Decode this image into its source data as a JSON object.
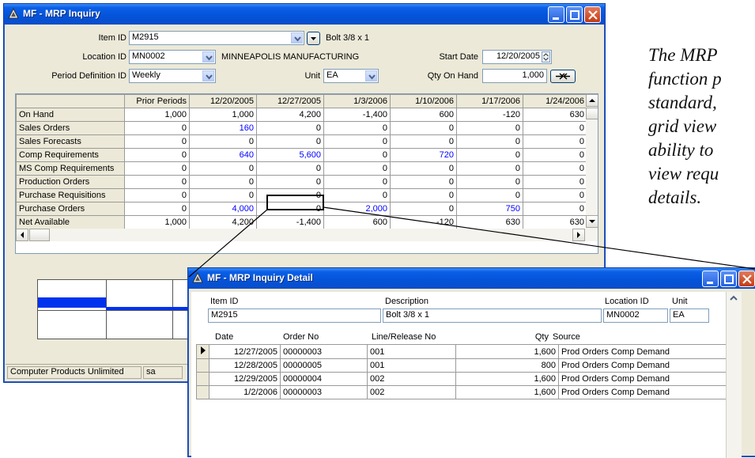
{
  "main_window": {
    "title": "MF - MRP Inquiry",
    "item_id_label": "Item ID",
    "item_id_value": "M2915",
    "item_description": "Bolt 3/8 x 1",
    "location_id_label": "Location ID",
    "location_id_value": "MN0002",
    "location_name": "MINNEAPOLIS MANUFACTURING",
    "start_date_label": "Start Date",
    "start_date_value": "12/20/2005",
    "period_label": "Period Definition ID",
    "period_value": "Weekly",
    "unit_label": "Unit",
    "unit_value": "EA",
    "qty_on_hand_label": "Qty On Hand",
    "qty_on_hand_value": "1,000",
    "grid": {
      "columns": [
        "",
        "Prior Periods",
        "12/20/2005",
        "12/27/2005",
        "1/3/2006",
        "1/10/2006",
        "1/17/2006",
        "1/24/2006"
      ],
      "rows": [
        {
          "label": "On Hand",
          "values": [
            "1,000",
            "1,000",
            "4,200",
            "-1,400",
            "600",
            "-120",
            "630"
          ]
        },
        {
          "label": "Sales Orders",
          "values": [
            "0",
            "160",
            "0",
            "0",
            "0",
            "0",
            "0"
          ]
        },
        {
          "label": "Sales Forecasts",
          "values": [
            "0",
            "0",
            "0",
            "0",
            "0",
            "0",
            "0"
          ]
        },
        {
          "label": "Comp Requirements",
          "values": [
            "0",
            "640",
            "5,600",
            "0",
            "720",
            "0",
            "0"
          ]
        },
        {
          "label": "MS Comp Requirements",
          "values": [
            "0",
            "0",
            "0",
            "0",
            "0",
            "0",
            "0"
          ]
        },
        {
          "label": "Production Orders",
          "values": [
            "0",
            "0",
            "0",
            "0",
            "0",
            "0",
            "0"
          ]
        },
        {
          "label": "Purchase Requisitions",
          "values": [
            "0",
            "0",
            "0",
            "0",
            "0",
            "0",
            "0"
          ]
        },
        {
          "label": "Purchase Orders",
          "values": [
            "0",
            "4,000",
            "0",
            "2,000",
            "0",
            "750",
            "0"
          ]
        },
        {
          "label": "Net Available",
          "values": [
            "1,000",
            "4,200",
            "-1,400",
            "600",
            "-120",
            "630",
            "630"
          ]
        }
      ]
    },
    "status_company": "Computer Products Unlimited",
    "status_user": "sa"
  },
  "detail_window": {
    "title": "MF - MRP Inquiry Detail",
    "item_id_label": "Item ID",
    "item_id_value": "M2915",
    "description_label": "Description",
    "description_value": "Bolt 3/8 x 1",
    "location_id_label": "Location ID",
    "location_id_value": "MN0002",
    "unit_label": "Unit",
    "unit_value": "EA",
    "columns": [
      "Date",
      "Order No",
      "Line/Release No",
      "Qty",
      "Source"
    ],
    "rows": [
      {
        "date": "12/27/2005",
        "order_no": "00000003",
        "line": "001",
        "qty": "1,600",
        "source": "Prod Orders Comp Demand"
      },
      {
        "date": "12/28/2005",
        "order_no": "00000005",
        "line": "001",
        "qty": "800",
        "source": "Prod Orders Comp Demand"
      },
      {
        "date": "12/29/2005",
        "order_no": "00000004",
        "line": "002",
        "qty": "1,600",
        "source": "Prod Orders Comp Demand"
      },
      {
        "date": "1/2/2006",
        "order_no": "00000003",
        "line": "002",
        "qty": "1,600",
        "source": "Prod Orders Comp Demand"
      }
    ]
  },
  "caption_lines": [
    "The MRP",
    "function p",
    "standard,",
    "grid view",
    "ability to",
    "view requ",
    "details."
  ],
  "colors": {
    "title_bar": "#0453d9",
    "link_blue": "#0000ff",
    "graph_bar": "#0033ee"
  },
  "icons": [
    "app-icon",
    "minimize-icon",
    "maximize-icon",
    "close-icon",
    "dropdown-icon",
    "go-arrow-icon",
    "row-pointer-icon"
  ]
}
